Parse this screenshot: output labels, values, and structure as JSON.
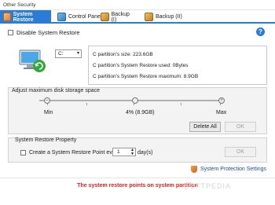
{
  "window": {
    "title": "Other Security"
  },
  "tabs": [
    {
      "label": "System Restore",
      "icon": "shield-icon"
    },
    {
      "label": "Control Panel",
      "icon": "control-panel-icon"
    },
    {
      "label": "Backup (I)",
      "icon": "backup-icon"
    },
    {
      "label": "Backup (II)",
      "icon": "backup-icon"
    }
  ],
  "disable": {
    "label": "Disable System Restore",
    "checked": false
  },
  "help": "?",
  "drive": {
    "selected": "C:"
  },
  "info": {
    "size": "C partition's size: 223.6GB",
    "used": "C partition's System Restore used: 0Bytes",
    "max": "C partition's System Restore maximum: 8.9GB"
  },
  "storage": {
    "title": "Adjust maximum disk storage space",
    "min_label": "Min",
    "value_label": "4% (8.9GB)",
    "max_label": "Max",
    "level_percent": 4,
    "delete_label": "Delete All",
    "ok_label": "OK"
  },
  "property": {
    "title": "System Restore Property",
    "create_label": "Create a System Restore Point every",
    "days_value": "1",
    "days_unit": "day(s)",
    "ok_label": "OK"
  },
  "settings_link": "System Protection Settings",
  "footer_message": "The system restore points on system partition",
  "watermark": "SOFTPEDIA",
  "colors": {
    "accent": "#2a7cd6",
    "footer_text": "#e02020"
  }
}
